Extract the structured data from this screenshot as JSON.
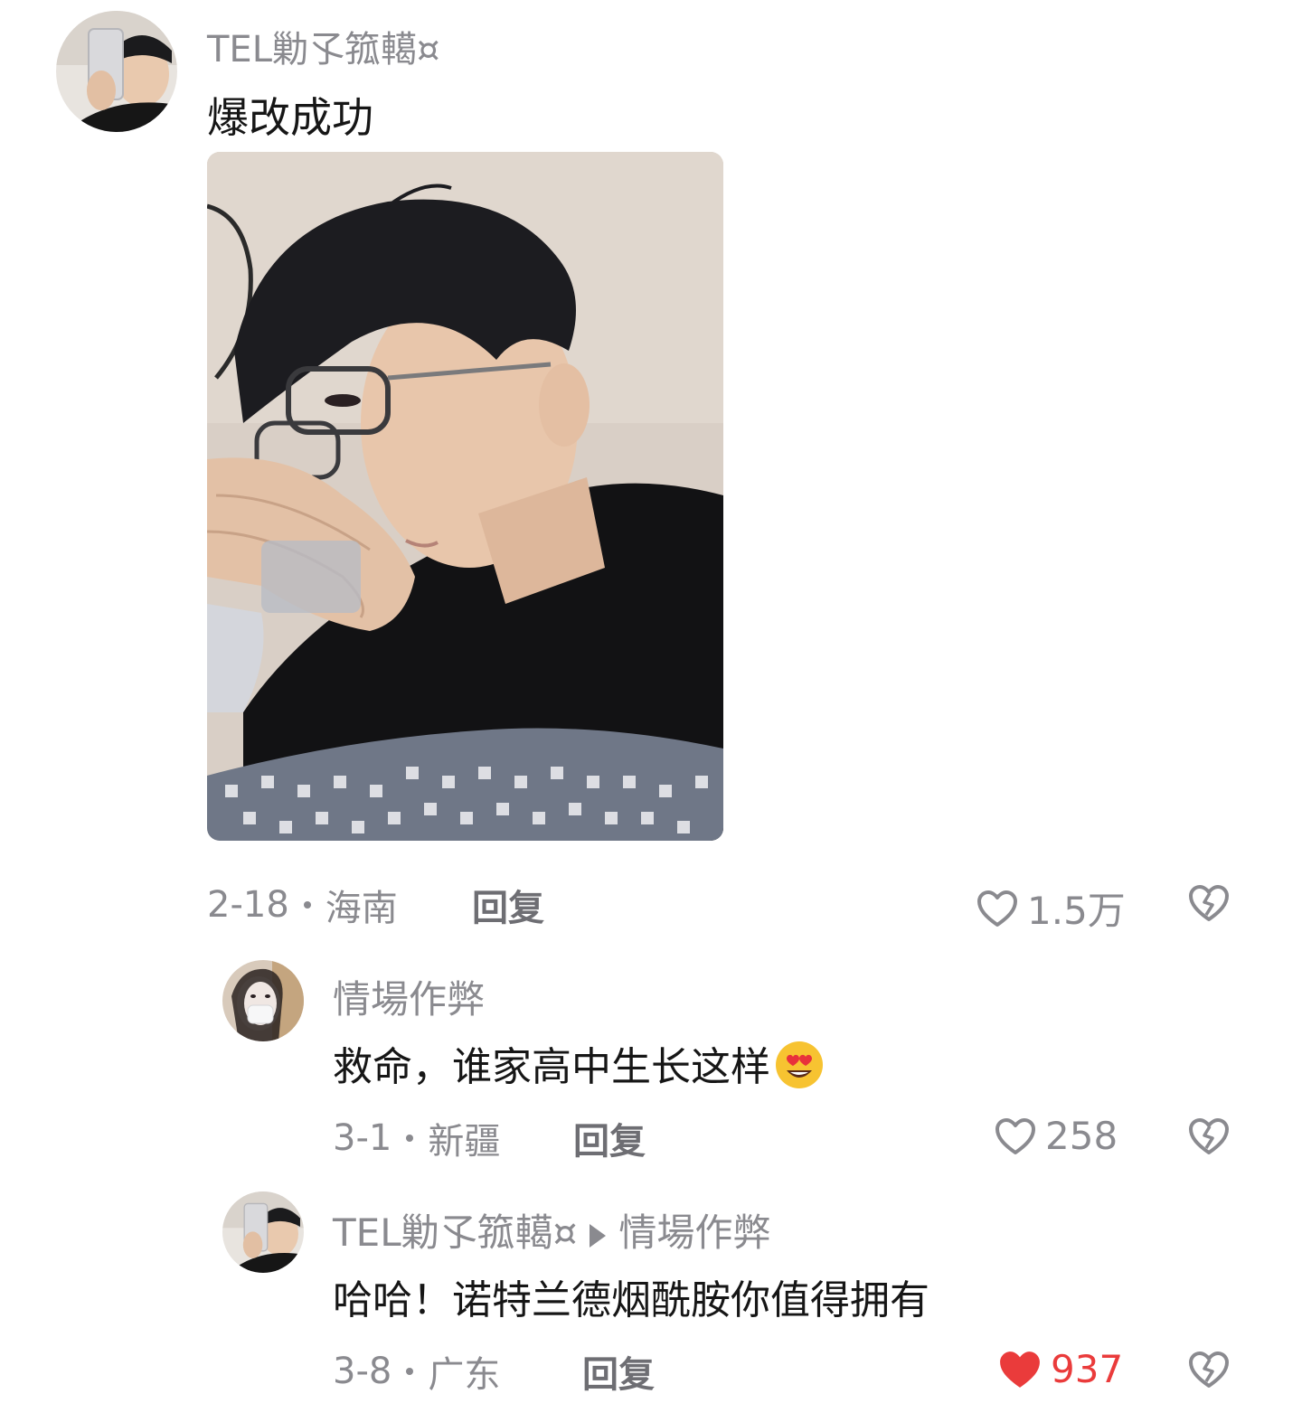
{
  "comments": [
    {
      "username": "TEL勦孓箛轕¤",
      "text": "爆改成功",
      "date": "2-18",
      "location": "海南",
      "reply_label": "回复",
      "likes": "1.5万",
      "liked": false
    },
    {
      "username": "情場作弊",
      "text": "救命，谁家高中生长这样",
      "emoji": "😍",
      "date": "3-1",
      "location": "新疆",
      "reply_label": "回复",
      "likes": "258",
      "liked": false
    },
    {
      "username": "TEL勦孓箛轕¤",
      "reply_to": "情場作弊",
      "text": "哈哈！诺特兰德烟酰胺你值得拥有",
      "date": "3-8",
      "location": "广东",
      "reply_label": "回复",
      "likes": "937",
      "liked": true
    }
  ],
  "colors": {
    "muted_text": "#8a8a8f",
    "like_active": "#ea3b3b",
    "body_text": "#161616"
  },
  "icons": {
    "like": "heart-outline-icon",
    "liked": "heart-filled-icon",
    "dislike": "broken-heart-icon",
    "reply_arrow": "triangle-right-icon"
  }
}
